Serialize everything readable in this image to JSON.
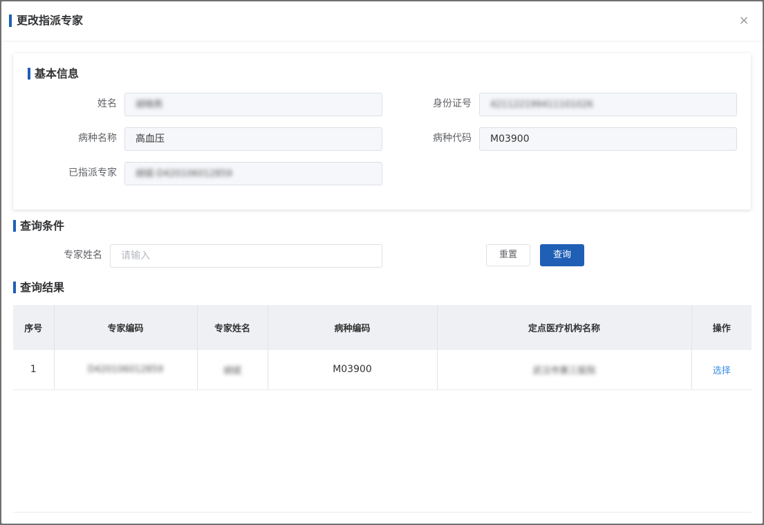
{
  "modal": {
    "title": "更改指派专家",
    "close_symbol": "×"
  },
  "basic_info": {
    "title": "基本信息",
    "name_label": "姓名",
    "name_value": "胡晓燕",
    "id_label": "身份证号",
    "id_value": "421122199411101026",
    "disease_name_label": "病种名称",
    "disease_name_value": "高血压",
    "disease_code_label": "病种代码",
    "disease_code_value": "M03900",
    "assigned_expert_label": "已指派专家",
    "assigned_expert_value": "胡斌-D420106012859"
  },
  "query": {
    "title": "查询条件",
    "expert_name_label": "专家姓名",
    "expert_name_placeholder": "请输入",
    "reset_label": "重置",
    "query_label": "查询"
  },
  "results": {
    "title": "查询结果",
    "columns": [
      "序号",
      "专家编码",
      "专家姓名",
      "病种编码",
      "定点医疗机构名称",
      "操作"
    ],
    "rows": [
      {
        "index": "1",
        "expert_code": "D420106012859",
        "expert_name": "胡斌",
        "disease_code": "M03900",
        "institution": "武汉市第三医院",
        "action": "选择"
      }
    ]
  },
  "colors": {
    "accent": "#1f5fb6",
    "link": "#3a8ee6"
  }
}
